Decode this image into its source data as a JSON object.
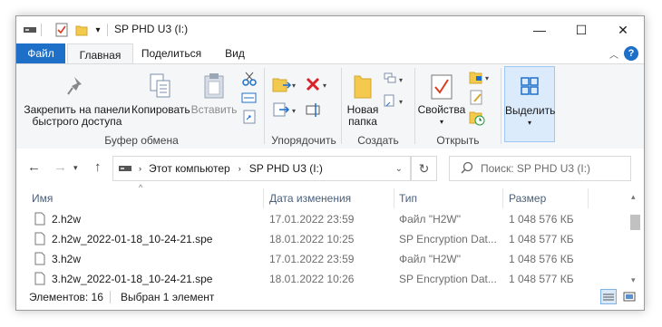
{
  "window": {
    "title": "SP PHD U3 (I:)"
  },
  "quick_access": {
    "drive": "drive-icon",
    "properties": "properties-icon",
    "new_folder": "new-folder-icon",
    "customize": "▾"
  },
  "window_controls": {
    "minimize": "—",
    "maximize": "☐",
    "close": "✕"
  },
  "tabs": [
    {
      "label": "Файл"
    },
    {
      "label": "Главная"
    },
    {
      "label": "Поделиться"
    },
    {
      "label": "Вид"
    }
  ],
  "ribbon": {
    "clipboard": {
      "pin_label_1": "Закрепить на панели",
      "pin_label_2": "быстрого доступа",
      "copy_label": "Копировать",
      "paste_label": "Вставить",
      "group_label": "Буфер обмена"
    },
    "organize": {
      "group_label": "Упорядочить"
    },
    "new": {
      "folder_label_1": "Новая",
      "folder_label_2": "папка",
      "group_label": "Создать"
    },
    "open": {
      "properties_label": "Свойства",
      "group_label": "Открыть"
    },
    "select": {
      "select_label": "Выделить"
    }
  },
  "nav": {
    "back": "←",
    "forward": "→",
    "up": "↑",
    "path": [
      "Этот компьютер",
      "SP PHD U3 (I:)"
    ],
    "search_placeholder": "Поиск: SP PHD U3 (I:)"
  },
  "columns": [
    "Имя",
    "Дата изменения",
    "Тип",
    "Размер"
  ],
  "files": [
    {
      "name": "2.h2w",
      "date": "17.01.2022 23:59",
      "type": "Файл \"H2W\"",
      "size": "1 048 576 КБ"
    },
    {
      "name": "2.h2w_2022-01-18_10-24-21.spe",
      "date": "18.01.2022 10:25",
      "type": "SP Encryption Dat...",
      "size": "1 048 577 КБ"
    },
    {
      "name": "3.h2w",
      "date": "17.01.2022 23:59",
      "type": "Файл \"H2W\"",
      "size": "1 048 576 КБ"
    },
    {
      "name": "3.h2w_2022-01-18_10-24-21.spe",
      "date": "18.01.2022 10:26",
      "type": "SP Encryption Dat...",
      "size": "1 048 577 КБ"
    }
  ],
  "status": {
    "items": "Элементов: 16",
    "selected": "Выбран 1 элемент"
  },
  "colors": {
    "accent": "#1e6fc8",
    "header_text": "#4c607a",
    "ribbon_bg": "#f5f6f7"
  }
}
